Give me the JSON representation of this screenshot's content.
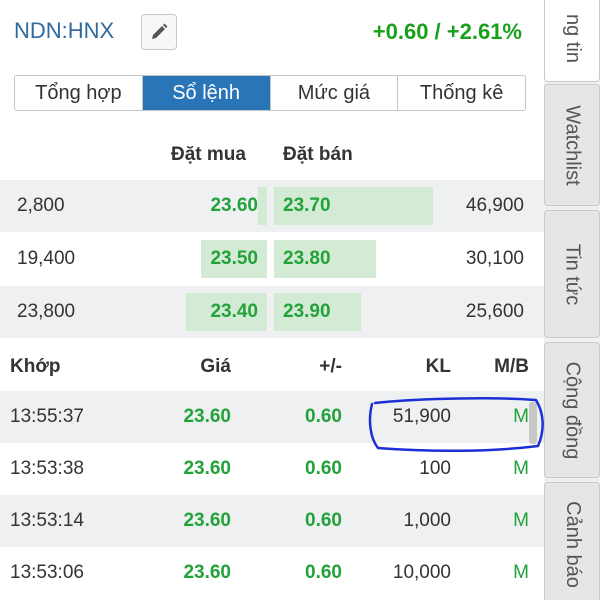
{
  "header": {
    "symbol": "NDN:HNX",
    "change": "+0.60 / +2.61%"
  },
  "tabs": [
    {
      "label": "Tổng hợp",
      "active": false
    },
    {
      "label": "Sổ lệnh",
      "active": true
    },
    {
      "label": "Mức giá",
      "active": false
    },
    {
      "label": "Thống kê",
      "active": false
    }
  ],
  "orderbook": {
    "bid_header": "Đặt mua",
    "ask_header": "Đặt bán",
    "rows": [
      {
        "bid_volume": "2,800",
        "bid_price": "23.60",
        "ask_price": "23.70",
        "ask_volume": "46,900"
      },
      {
        "bid_volume": "19,400",
        "bid_price": "23.50",
        "ask_price": "23.80",
        "ask_volume": "30,100"
      },
      {
        "bid_volume": "23,800",
        "bid_price": "23.40",
        "ask_price": "23.90",
        "ask_volume": "25,600"
      }
    ]
  },
  "trades": {
    "headers": {
      "time": "Khớp",
      "price": "Giá",
      "change": "+/-",
      "volume": "KL",
      "side": "M/B"
    },
    "rows": [
      {
        "time": "13:55:37",
        "price": "23.60",
        "change": "0.60",
        "volume": "51,900",
        "side": "M"
      },
      {
        "time": "13:53:38",
        "price": "23.60",
        "change": "0.60",
        "volume": "100",
        "side": "M"
      },
      {
        "time": "13:53:14",
        "price": "23.60",
        "change": "0.60",
        "volume": "1,000",
        "side": "M"
      },
      {
        "time": "13:53:06",
        "price": "23.60",
        "change": "0.60",
        "volume": "10,000",
        "side": "M"
      }
    ]
  },
  "side_tabs": [
    {
      "label": "ng tin",
      "active": true
    },
    {
      "label": "Watchlist",
      "active": false
    },
    {
      "label": "Tin tức",
      "active": false
    },
    {
      "label": "Cộng đồng",
      "active": false
    },
    {
      "label": "Cảnh báo",
      "active": false
    }
  ],
  "colors": {
    "accent": "#2a74b8",
    "up": "#23a23a",
    "bar": "#d3ead5",
    "annotation": "#1a2fd6"
  },
  "icons": {
    "edit": "pencil-icon"
  }
}
